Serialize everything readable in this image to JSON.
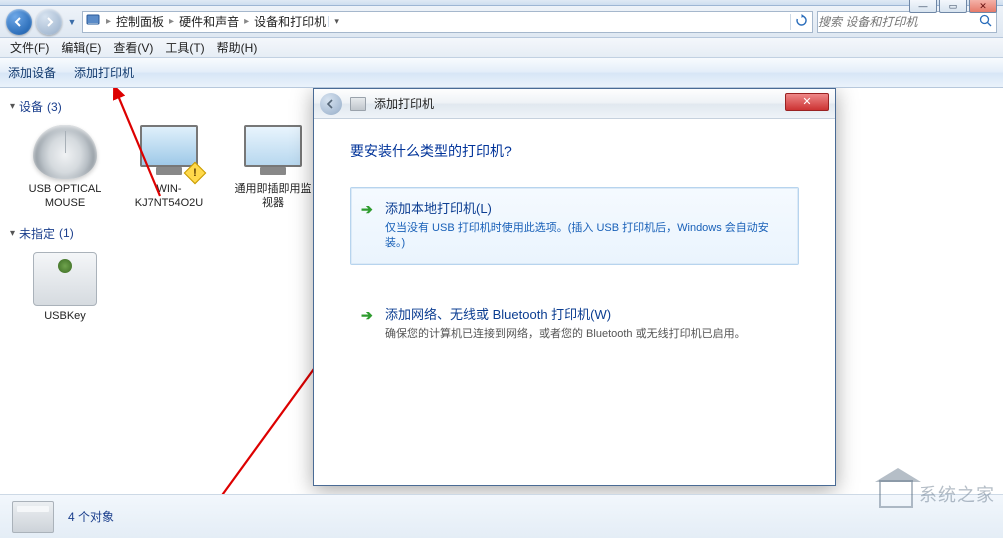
{
  "window_controls": {
    "min": "—",
    "max": "▭",
    "close": "✕"
  },
  "breadcrumb": {
    "seg1": "控制面板",
    "seg2": "硬件和声音",
    "seg3": "设备和打印机"
  },
  "search": {
    "placeholder": "搜索 设备和打印机"
  },
  "menubar": {
    "file": "文件(F)",
    "edit": "编辑(E)",
    "view": "查看(V)",
    "tools": "工具(T)",
    "help": "帮助(H)"
  },
  "toolbar": {
    "add_device": "添加设备",
    "add_printer": "添加打印机"
  },
  "groups": {
    "devices": {
      "label": "设备",
      "count": "(3)"
    },
    "unspecified": {
      "label": "未指定",
      "count": "(1)"
    }
  },
  "devices": {
    "mouse": "USB OPTICAL MOUSE",
    "pc": "WIN-KJ7NT54O2U",
    "monitor": "通用即插即用监视器",
    "usbkey": "USBKey"
  },
  "wizard": {
    "title": "添加打印机",
    "heading": "要安装什么类型的打印机?",
    "opt1_title": "添加本地打印机(L)",
    "opt1_desc": "仅当没有 USB 打印机时使用此选项。(插入 USB 打印机后，Windows 会自动安装。)",
    "opt2_title": "添加网络、无线或 Bluetooth 打印机(W)",
    "opt2_desc": "确保您的计算机已连接到网络，或者您的 Bluetooth 或无线打印机已启用。",
    "close": "✕"
  },
  "statusbar": {
    "count": "4 个对象"
  },
  "watermark": "系统之家"
}
